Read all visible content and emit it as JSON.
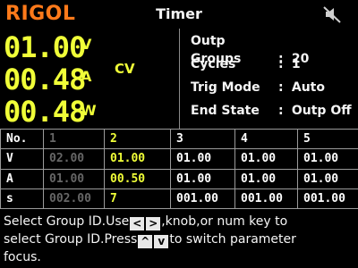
{
  "header": {
    "brand": "RIGOL",
    "title": "Timer"
  },
  "readout": {
    "voltage": "01.00",
    "voltage_unit": "V",
    "current": "00.48",
    "current_unit": "A",
    "power": "00.48",
    "power_unit": "W",
    "mode": "CV"
  },
  "settings": [
    {
      "label": "Outp Groups",
      "value": "20"
    },
    {
      "label": "Cycles",
      "value": "1"
    },
    {
      "label": "Trig Mode",
      "value": "Auto"
    },
    {
      "label": "End State",
      "value": "Outp Off"
    }
  ],
  "table": {
    "header": [
      "No.",
      "1",
      "2",
      "3",
      "4",
      "5"
    ],
    "rows": [
      [
        "V",
        "02.00",
        "01.00",
        "01.00",
        "01.00",
        "01.00"
      ],
      [
        "A",
        "01.00",
        "00.50",
        "01.00",
        "01.00",
        "01.00"
      ],
      [
        "s",
        "002.00",
        "7",
        "001.00",
        "001.00",
        "001.00"
      ]
    ]
  },
  "help": {
    "part1": "Select Group ID.Use",
    "left_key": "<",
    "right_key": ">",
    "part2": ",knob,or num key to",
    "part3": "select Group ID.Press",
    "up_key": "^",
    "down_key": "v",
    "part4": "to switch parameter",
    "part5": "focus."
  },
  "colors": {
    "brand": "#ff7a1a",
    "readout": "#f0ff38",
    "dim": "#666666",
    "background": "#000000"
  }
}
